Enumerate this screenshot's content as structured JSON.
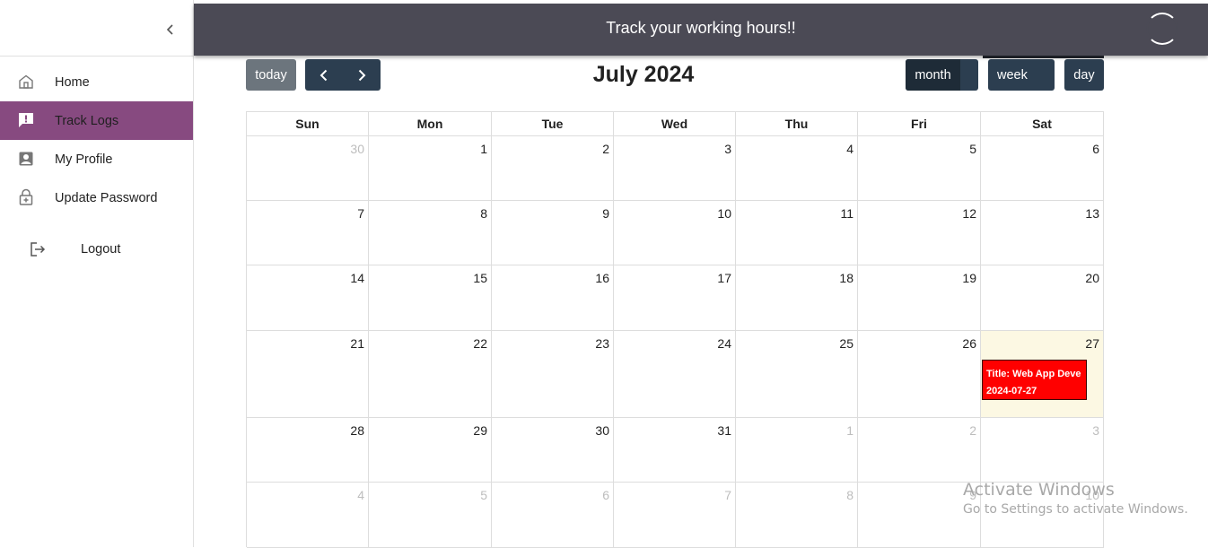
{
  "app": {
    "header_title": "Track your working hours!!"
  },
  "sidebar": {
    "items": [
      {
        "label": "Home",
        "icon": "home-icon"
      },
      {
        "label": "Track Logs",
        "icon": "feedback-icon",
        "active": true
      },
      {
        "label": "My Profile",
        "icon": "profile-icon"
      },
      {
        "label": "Update Password",
        "icon": "lock-icon"
      }
    ],
    "logout_label": "Logout",
    "active_color": "#874a80"
  },
  "toolbar": {
    "today_label": "today",
    "title": "July 2024",
    "views": {
      "month": "month",
      "week": "week",
      "day": "day"
    },
    "active_view": "month"
  },
  "calendar": {
    "weekdays": [
      "Sun",
      "Mon",
      "Tue",
      "Wed",
      "Thu",
      "Fri",
      "Sat"
    ],
    "weeks": [
      [
        {
          "d": "30",
          "o": true
        },
        {
          "d": "1"
        },
        {
          "d": "2"
        },
        {
          "d": "3"
        },
        {
          "d": "4"
        },
        {
          "d": "5"
        },
        {
          "d": "6"
        }
      ],
      [
        {
          "d": "7"
        },
        {
          "d": "8"
        },
        {
          "d": "9"
        },
        {
          "d": "10"
        },
        {
          "d": "11"
        },
        {
          "d": "12"
        },
        {
          "d": "13"
        }
      ],
      [
        {
          "d": "14"
        },
        {
          "d": "15"
        },
        {
          "d": "16"
        },
        {
          "d": "17"
        },
        {
          "d": "18"
        },
        {
          "d": "19"
        },
        {
          "d": "20"
        }
      ],
      [
        {
          "d": "21"
        },
        {
          "d": "22"
        },
        {
          "d": "23"
        },
        {
          "d": "24"
        },
        {
          "d": "25"
        },
        {
          "d": "26"
        },
        {
          "d": "27",
          "today": true
        }
      ],
      [
        {
          "d": "28"
        },
        {
          "d": "29"
        },
        {
          "d": "30"
        },
        {
          "d": "31"
        },
        {
          "d": "1",
          "o": true
        },
        {
          "d": "2",
          "o": true
        },
        {
          "d": "3",
          "o": true
        }
      ],
      [
        {
          "d": "4",
          "o": true
        },
        {
          "d": "5",
          "o": true
        },
        {
          "d": "6",
          "o": true
        },
        {
          "d": "7",
          "o": true
        },
        {
          "d": "8",
          "o": true
        },
        {
          "d": "9",
          "o": true
        },
        {
          "d": "10",
          "o": true
        }
      ]
    ],
    "events": [
      {
        "week": 3,
        "day": 6,
        "title": "Title: Web App Deve",
        "date": "2024-07-27",
        "color": "#ff0000"
      }
    ]
  },
  "watermark": {
    "line1": "Activate Windows",
    "line2": "Go to Settings to activate Windows."
  }
}
